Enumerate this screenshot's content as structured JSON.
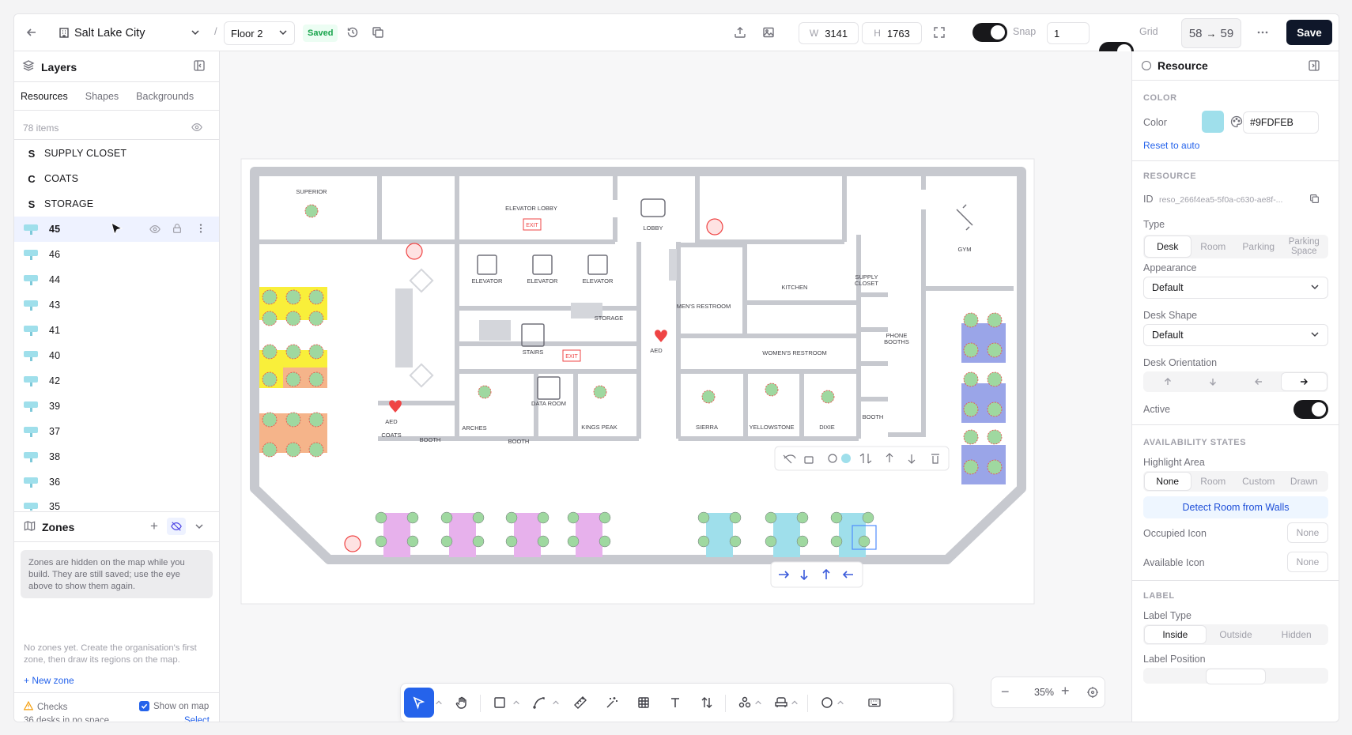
{
  "topbar": {
    "location": "Salt Lake City",
    "floor": "Floor 2",
    "saved_badge": "Saved",
    "width_prefix": "W",
    "width_value": "3141",
    "height_prefix": "H",
    "height_value": "1763",
    "snap_label": "Snap",
    "snap_value": "1",
    "grid_label": "Grid",
    "count_from": "58",
    "count_arrow": "→",
    "count_to": "59",
    "save_label": "Save",
    "separator": "/"
  },
  "layers": {
    "title": "Layers",
    "tabs": [
      "Resources",
      "Shapes",
      "Backgrounds"
    ],
    "active_tab": 0,
    "count": "78 items",
    "items": [
      {
        "letter": "S",
        "name": "SUPPLY CLOSET",
        "kind": "text"
      },
      {
        "letter": "C",
        "name": "COATS",
        "kind": "text"
      },
      {
        "letter": "S",
        "name": "STORAGE",
        "kind": "text"
      },
      {
        "name": "45",
        "kind": "desk",
        "selected": true
      },
      {
        "name": "46",
        "kind": "desk"
      },
      {
        "name": "44",
        "kind": "desk"
      },
      {
        "name": "43",
        "kind": "desk"
      },
      {
        "name": "41",
        "kind": "desk"
      },
      {
        "name": "40",
        "kind": "desk"
      },
      {
        "name": "42",
        "kind": "desk"
      },
      {
        "name": "39",
        "kind": "desk"
      },
      {
        "name": "37",
        "kind": "desk"
      },
      {
        "name": "38",
        "kind": "desk"
      },
      {
        "name": "36",
        "kind": "desk"
      },
      {
        "name": "35",
        "kind": "desk"
      }
    ]
  },
  "zones": {
    "title": "Zones",
    "hidden_note": "Zones are hidden on the map while you build. They are still saved; use the eye above to show them again.",
    "empty_note": "No zones yet. Create the organisation's first zone, then draw its regions on the map.",
    "new_zone": "+ New zone"
  },
  "checks": {
    "title": "Checks",
    "show_on_map": "Show on map",
    "status": "36 desks in no space",
    "select": "Select"
  },
  "inspector": {
    "title": "Resource",
    "color_section": "COLOR",
    "color_label": "Color",
    "color_hex": "#9FDFEB",
    "reset": "Reset to auto",
    "resource_section": "RESOURCE",
    "id_label": "ID",
    "id_value": "reso_266f4ea5-5f0a-c630-ae8f-...",
    "type_label": "Type",
    "types": [
      "Desk",
      "Room",
      "Parking",
      "Parking Space"
    ],
    "appearance_label": "Appearance",
    "appearance_value": "Default",
    "shape_label": "Desk Shape",
    "shape_value": "Default",
    "orientation_label": "Desk Orientation",
    "active_label": "Active",
    "avail_section": "AVAILABILITY STATES",
    "highlight_label": "Highlight Area",
    "highlights": [
      "None",
      "Room",
      "Custom",
      "Drawn"
    ],
    "detect": "Detect Room from Walls",
    "occupied_label": "Occupied Icon",
    "available_label": "Available Icon",
    "none": "None",
    "label_section": "LABEL",
    "label_type": "Label Type",
    "label_types": [
      "Inside",
      "Outside",
      "Hidden"
    ],
    "label_position": "Label Position"
  },
  "zoom": {
    "value": "35%"
  },
  "map": {
    "rooms": [
      "SUPERIOR",
      "ELEVATOR LOBBY",
      "EXIT",
      "LOBBY",
      "GYM",
      "ELEVATOR",
      "KITCHEN",
      "SUPPLY CLOSET",
      "STORAGE",
      "STAIRS",
      "MEN'S RESTROOM",
      "AED",
      "PHONE BOOTHS",
      "WOMEN'S RESTROOM",
      "DATA ROOM",
      "ARCHES",
      "BOOTH",
      "KINGS PEAK",
      "SIERRA",
      "YELLOWSTONE",
      "DIXIE",
      "COATS"
    ],
    "colors": {
      "yellow": "#f9ef3a",
      "orange": "#f5b48a",
      "blue": "#9aa5e8",
      "purple": "#e7b1ec",
      "cyan": "#9fdfeb",
      "green": "#9fd8a0",
      "wall": "#c7c9cf"
    }
  }
}
